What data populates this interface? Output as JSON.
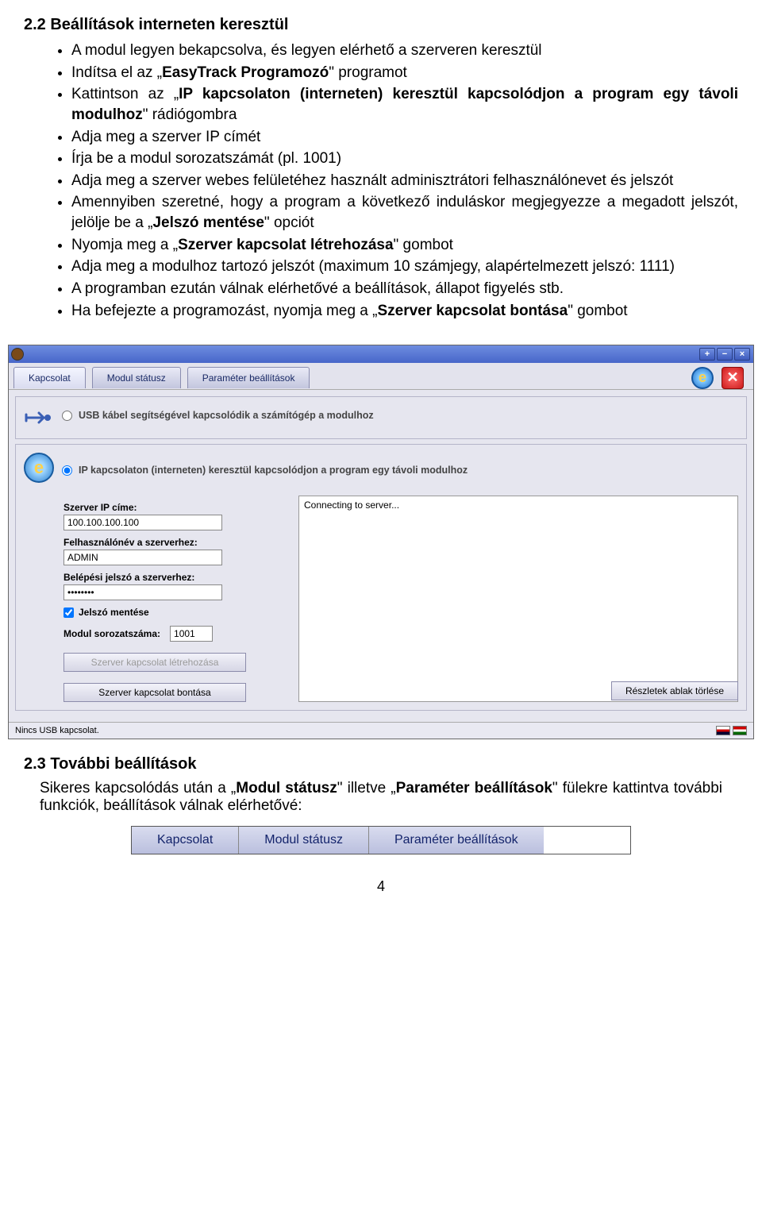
{
  "section22": {
    "title": "2.2  Beállítások interneten keresztül",
    "bullets": [
      "A modul legyen bekapcsolva, és legyen elérhető a szerveren keresztül",
      "Indítsa el az „<b>EasyTrack Programozó</b>\" programot",
      "Kattintson az „<b>IP kapcsolaton (interneten) keresztül kapcsolódjon a program egy távoli modulhoz</b>\" rádiógombra",
      "Adja meg a szerver IP címét",
      "Írja be a modul sorozatszámát (pl. 1001)",
      "Adja meg a szerver webes felületéhez használt adminisztrátori felhasználónevet és jelszót",
      "Amennyiben szeretné, hogy a program a következő induláskor megjegyezze a megadott jelszót, jelölje be a „<b>Jelszó mentése</b>\" opciót",
      "Nyomja meg a „<b>Szerver kapcsolat létrehozása</b>\" gombot",
      "Adja meg a modulhoz tartozó jelszót (maximum 10 számjegy, alapértelmezett jelszó: 1111)",
      "A programban ezután válnak elérhetővé a beállítások, állapot figyelés stb.",
      "Ha befejezte a programozást, nyomja meg a „<b>Szerver kapcsolat bontása</b>\" gombot"
    ]
  },
  "app": {
    "titlebar_buttons": [
      "+",
      "−",
      "×"
    ],
    "tabs": [
      "Kapcsolat",
      "Modul státusz",
      "Paraméter beállítások"
    ],
    "usb_radio_label": "USB kábel segítségével kapcsolódik a számítógép a modulhoz",
    "ip_radio_label": "IP kapcsolaton (interneten) keresztül kapcsolódjon a program egy távoli modulhoz",
    "labels": {
      "server_ip": "Szerver IP címe:",
      "username": "Felhasználónév a szerverhez:",
      "password": "Belépési jelszó a szerverhez:",
      "save_pw": "Jelszó mentése",
      "serial": "Modul sorozatszáma:"
    },
    "values": {
      "server_ip": "100.100.100.100",
      "username": "ADMIN",
      "password": "••••••••",
      "serial": "1001"
    },
    "buttons": {
      "connect": "Szerver kapcsolat létrehozása",
      "disconnect": "Szerver kapcsolat bontása",
      "clear_log": "Részletek ablak törlése"
    },
    "log": "Connecting to server...",
    "status": "Nincs USB kapcsolat."
  },
  "section23": {
    "title": "2.3  További beállítások",
    "text": "Sikeres kapcsolódás után a „<b>Modul státusz</b>\" illetve „<b>Paraméter beállítások</b>\" fülekre kattintva további funkciók, beállítások válnak elérhetővé:"
  },
  "tabs_strip": [
    "Kapcsolat",
    "Modul státusz",
    "Paraméter beállítások"
  ],
  "page_number": "4"
}
